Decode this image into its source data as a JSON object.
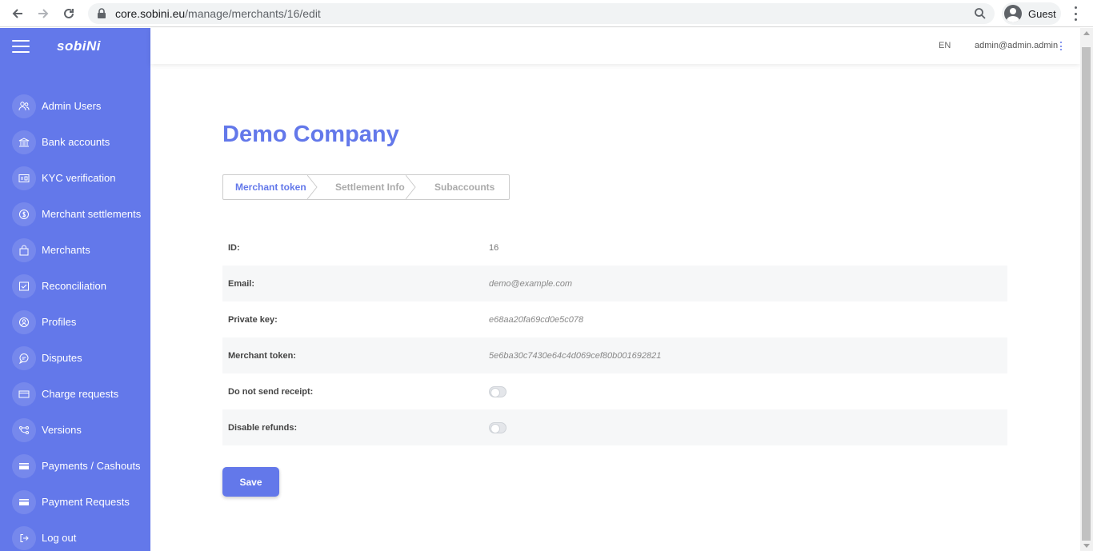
{
  "browser": {
    "url_host": "core.sobini.eu",
    "url_path": "/manage/merchants/16/edit",
    "profile_name": "Guest"
  },
  "sidebar": {
    "brand": "sobiNi",
    "items": [
      {
        "label": "Admin Users",
        "icon": "users-icon"
      },
      {
        "label": "Bank accounts",
        "icon": "bank-icon"
      },
      {
        "label": "KYC verification",
        "icon": "id-card-icon"
      },
      {
        "label": "Merchant settlements",
        "icon": "dollar-coin-icon"
      },
      {
        "label": "Merchants",
        "icon": "shopping-bag-icon"
      },
      {
        "label": "Reconciliation",
        "icon": "checklist-icon"
      },
      {
        "label": "Profiles",
        "icon": "user-circle-icon"
      },
      {
        "label": "Disputes",
        "icon": "chat-bubble-icon"
      },
      {
        "label": "Charge requests",
        "icon": "card-icon"
      },
      {
        "label": "Versions",
        "icon": "branch-icon"
      },
      {
        "label": "Payments / Cashouts",
        "icon": "card-filled-icon"
      },
      {
        "label": "Payment Requests",
        "icon": "card-filled-icon"
      },
      {
        "label": "Log out",
        "icon": "logout-icon"
      }
    ]
  },
  "header": {
    "lang": "EN",
    "user_email": "admin@admin.admin"
  },
  "main": {
    "title": "Demo Company",
    "tabs": [
      {
        "label": "Merchant token",
        "active": true
      },
      {
        "label": "Settlement Info",
        "active": false
      },
      {
        "label": "Subaccounts",
        "active": false
      }
    ],
    "fields": {
      "id": {
        "label": "ID:",
        "value": "16"
      },
      "email": {
        "label": "Email:",
        "value": "demo@example.com"
      },
      "private_key": {
        "label": "Private key:",
        "value": "e68aa20fa69cd0e5c078"
      },
      "merchant_token": {
        "label": "Merchant token:",
        "value": "5e6ba30c7430e64c4d069cef80b001692821"
      },
      "do_not_send_receipt": {
        "label": "Do not send receipt:",
        "value": false
      },
      "disable_refunds": {
        "label": "Disable refunds:",
        "value": false
      }
    },
    "save_label": "Save"
  },
  "colors": {
    "accent": "#6378ea",
    "row_alt": "#f6f7f8"
  }
}
